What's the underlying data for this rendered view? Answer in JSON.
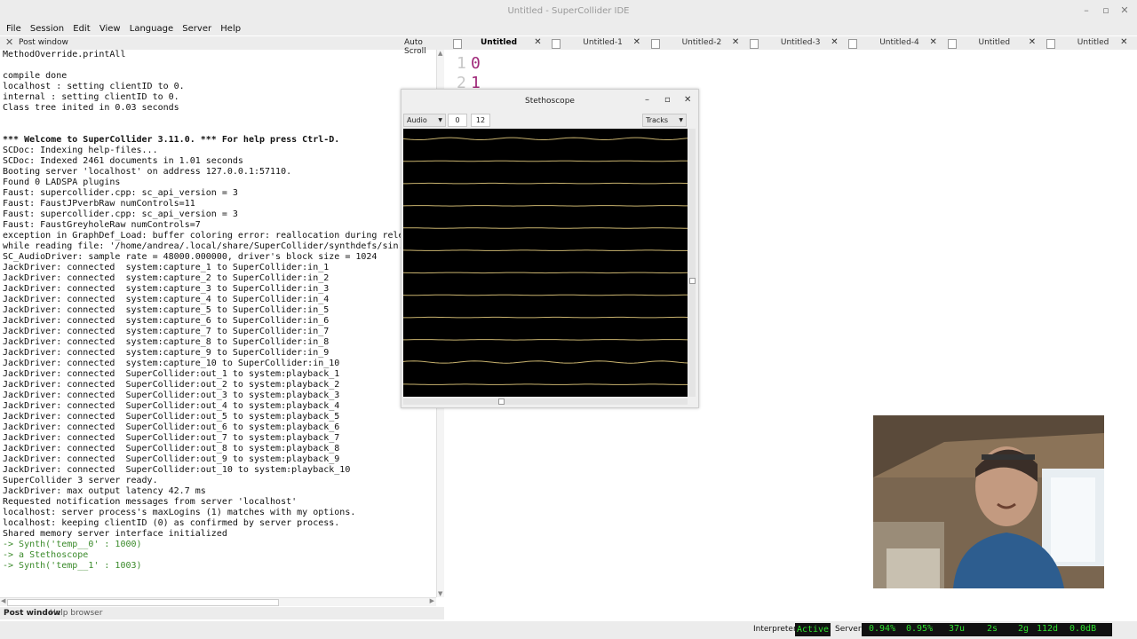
{
  "window": {
    "title": "Untitled - SuperCollider IDE",
    "minimize": "–",
    "maximize": "▫",
    "close": "✕"
  },
  "menu": [
    "File",
    "Session",
    "Edit",
    "View",
    "Language",
    "Server",
    "Help"
  ],
  "post_window": {
    "title": "Post window",
    "close": "✕",
    "auto_scroll_label": "Auto Scroll",
    "lines": [
      {
        "text": "MethodOverride.printAll",
        "style": ""
      },
      {
        "text": "",
        "style": ""
      },
      {
        "text": "compile done",
        "style": ""
      },
      {
        "text": "localhost : setting clientID to 0.",
        "style": ""
      },
      {
        "text": "internal : setting clientID to 0.",
        "style": ""
      },
      {
        "text": "Class tree inited in 0.03 seconds",
        "style": ""
      },
      {
        "text": "",
        "style": ""
      },
      {
        "text": "",
        "style": ""
      },
      {
        "text": "*** Welcome to SuperCollider 3.11.0. *** For help press Ctrl-D.",
        "style": "b"
      },
      {
        "text": "SCDoc: Indexing help-files...",
        "style": ""
      },
      {
        "text": "SCDoc: Indexed 2461 documents in 1.01 seconds",
        "style": ""
      },
      {
        "text": "Booting server 'localhost' on address 127.0.0.1:57110.",
        "style": ""
      },
      {
        "text": "Found 0 LADSPA plugins",
        "style": ""
      },
      {
        "text": "Faust: supercollider.cpp: sc_api_version = 3",
        "style": ""
      },
      {
        "text": "Faust: FaustJPverbRaw numControls=11",
        "style": ""
      },
      {
        "text": "Faust: supercollider.cpp: sc_api_version = 3",
        "style": ""
      },
      {
        "text": "Faust: FaustGreyholeRaw numControls=7",
        "style": ""
      },
      {
        "text": "exception in GraphDef_Load: buffer coloring error: reallocation during rele",
        "style": ""
      },
      {
        "text": "while reading file: '/home/andrea/.local/share/SuperCollider/synthdefs/sin.",
        "style": ""
      },
      {
        "text": "SC_AudioDriver: sample rate = 48000.000000, driver's block size = 1024",
        "style": ""
      },
      {
        "text": "JackDriver: connected  system:capture_1 to SuperCollider:in_1",
        "style": ""
      },
      {
        "text": "JackDriver: connected  system:capture_2 to SuperCollider:in_2",
        "style": ""
      },
      {
        "text": "JackDriver: connected  system:capture_3 to SuperCollider:in_3",
        "style": ""
      },
      {
        "text": "JackDriver: connected  system:capture_4 to SuperCollider:in_4",
        "style": ""
      },
      {
        "text": "JackDriver: connected  system:capture_5 to SuperCollider:in_5",
        "style": ""
      },
      {
        "text": "JackDriver: connected  system:capture_6 to SuperCollider:in_6",
        "style": ""
      },
      {
        "text": "JackDriver: connected  system:capture_7 to SuperCollider:in_7",
        "style": ""
      },
      {
        "text": "JackDriver: connected  system:capture_8 to SuperCollider:in_8",
        "style": ""
      },
      {
        "text": "JackDriver: connected  system:capture_9 to SuperCollider:in_9",
        "style": ""
      },
      {
        "text": "JackDriver: connected  system:capture_10 to SuperCollider:in_10",
        "style": ""
      },
      {
        "text": "JackDriver: connected  SuperCollider:out_1 to system:playback_1",
        "style": ""
      },
      {
        "text": "JackDriver: connected  SuperCollider:out_2 to system:playback_2",
        "style": ""
      },
      {
        "text": "JackDriver: connected  SuperCollider:out_3 to system:playback_3",
        "style": ""
      },
      {
        "text": "JackDriver: connected  SuperCollider:out_4 to system:playback_4",
        "style": ""
      },
      {
        "text": "JackDriver: connected  SuperCollider:out_5 to system:playback_5",
        "style": ""
      },
      {
        "text": "JackDriver: connected  SuperCollider:out_6 to system:playback_6",
        "style": ""
      },
      {
        "text": "JackDriver: connected  SuperCollider:out_7 to system:playback_7",
        "style": ""
      },
      {
        "text": "JackDriver: connected  SuperCollider:out_8 to system:playback_8",
        "style": ""
      },
      {
        "text": "JackDriver: connected  SuperCollider:out_9 to system:playback_9",
        "style": ""
      },
      {
        "text": "JackDriver: connected  SuperCollider:out_10 to system:playback_10",
        "style": ""
      },
      {
        "text": "SuperCollider 3 server ready.",
        "style": ""
      },
      {
        "text": "JackDriver: max output latency 42.7 ms",
        "style": ""
      },
      {
        "text": "Requested notification messages from server 'localhost'",
        "style": ""
      },
      {
        "text": "localhost: server process's maxLogins (1) matches with my options.",
        "style": ""
      },
      {
        "text": "localhost: keeping clientID (0) as confirmed by server process.",
        "style": ""
      },
      {
        "text": "Shared memory server interface initialized",
        "style": ""
      },
      {
        "text": "-> Synth('temp__0' : 1000)",
        "style": "g"
      },
      {
        "text": "-> a Stethoscope",
        "style": "g"
      },
      {
        "text": "-> Synth('temp__1' : 1003)",
        "style": "g"
      }
    ]
  },
  "bottom_tabs": [
    "Post window",
    "Help browser"
  ],
  "editor_tabs": [
    {
      "label": "Untitled",
      "active": true
    },
    {
      "label": "Untitled-1",
      "active": false
    },
    {
      "label": "Untitled-2",
      "active": false
    },
    {
      "label": "Untitled-3",
      "active": false
    },
    {
      "label": "Untitled-4",
      "active": false
    },
    {
      "label": "Untitled",
      "active": false
    },
    {
      "label": "Untitled",
      "active": false
    }
  ],
  "editor": {
    "lines": [
      {
        "number": "1",
        "code": "0"
      },
      {
        "number": "2",
        "code": "1"
      }
    ]
  },
  "stethoscope": {
    "title": "Stethoscope",
    "rate": "Audio",
    "index": "0",
    "num_channels": "12",
    "style": "Tracks",
    "channel_count": 12,
    "channel_color": "#c8b26e"
  },
  "status": {
    "interpreter_label": "Interpreter:",
    "interpreter_state": "Active",
    "server_label": "Server:",
    "avg_cpu": "0.94%",
    "peak_cpu": "0.95%",
    "ugens": "37u",
    "synths": "2s",
    "groups": "2g",
    "synthdefs": "112d",
    "volume": "0.0dB"
  },
  "colors": {
    "chrome": "#ececec",
    "status_green": "#2ee02e",
    "post_green": "#3a8a2a",
    "code_purple": "#a0297a"
  }
}
